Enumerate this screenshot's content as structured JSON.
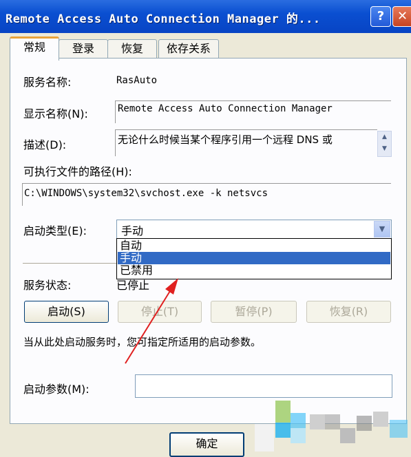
{
  "window": {
    "title": "Remote Access Auto Connection Manager 的...",
    "help_icon": "?",
    "close_icon": "✕"
  },
  "tabs": [
    "常规",
    "登录",
    "恢复",
    "依存关系"
  ],
  "general": {
    "service_name_label": "服务名称:",
    "service_name_value": "RasAuto",
    "display_name_label": "显示名称(N):",
    "display_name_value": "Remote Access Auto Connection Manager",
    "description_label": "描述(D):",
    "description_value": "无论什么时候当某个程序引用一个远程 DNS 或",
    "exe_path_label": "可执行文件的路径(H):",
    "exe_path_value": "C:\\WINDOWS\\system32\\svchost.exe -k netsvcs",
    "startup_type_label": "启动类型(E):",
    "startup_type_value": "手动",
    "startup_options": [
      "自动",
      "手动",
      "已禁用"
    ],
    "selected_option_index": 1,
    "service_status_label": "服务状态:",
    "service_status_value": "已停止",
    "buttons": {
      "start": "启动(S)",
      "stop": "停止(T)",
      "pause": "暂停(P)",
      "resume": "恢复(R)"
    },
    "hint": "当从此处启动服务时，您可指定所适用的启动参数。",
    "start_params_label": "启动参数(M):",
    "start_params_value": ""
  },
  "footer": {
    "ok": "确定"
  },
  "colors": {
    "titlebar": "#0a4fd1",
    "selection": "#316ac5",
    "annotation_arrow": "#e02020"
  }
}
